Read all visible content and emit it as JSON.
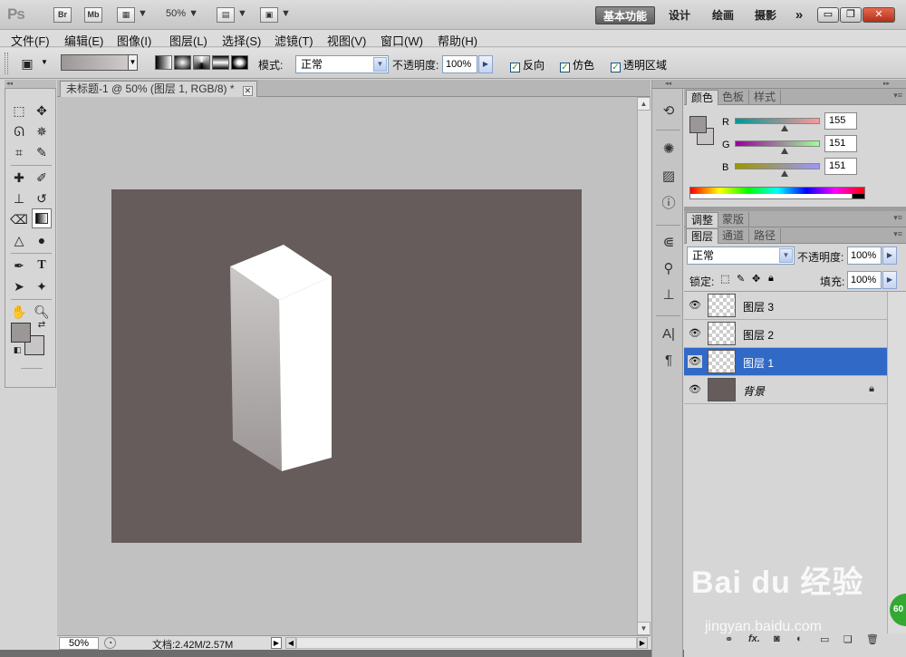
{
  "app": {
    "logo": "Ps",
    "bridge_label": "Br",
    "minibridge_label": "Mb",
    "zoom_display": "50%",
    "workspaces": [
      "基本功能",
      "设计",
      "绘画",
      "摄影"
    ],
    "more_label": "»"
  },
  "menu": [
    "文件(F)",
    "编辑(E)",
    "图像(I)",
    "图层(L)",
    "选择(S)",
    "滤镜(T)",
    "视图(V)",
    "窗口(W)",
    "帮助(H)"
  ],
  "options": {
    "mode_label": "模式:",
    "mode_value": "正常",
    "opacity_label": "不透明度:",
    "opacity_value": "100%",
    "reverse_label": "反向",
    "dither_label": "仿色",
    "transparency_label": "透明区域",
    "gradient_start_color": "#9b9797",
    "gradient_end_color": "#cfcbcb"
  },
  "document": {
    "tab_title": "未标题-1 @ 50% (图层 1, RGB/8) *",
    "canvas_color": "#665c5c",
    "zoom": "50%",
    "doc_info": "文档:2.42M/2.57M"
  },
  "colors": {
    "foreground": "#9b9797",
    "background": "#c7c5c5"
  },
  "color_panel": {
    "tabs": [
      "颜色",
      "色板",
      "样式"
    ],
    "channels": [
      {
        "label": "R",
        "value": "155"
      },
      {
        "label": "G",
        "value": "151"
      },
      {
        "label": "B",
        "value": "151"
      }
    ]
  },
  "adjust_panel": {
    "tabs": [
      "调整",
      "蒙版"
    ]
  },
  "layers_panel": {
    "tabs": [
      "图层",
      "通道",
      "路径"
    ],
    "blend_mode": "正常",
    "opacity_label": "不透明度:",
    "opacity_value": "100%",
    "lock_label": "锁定:",
    "fill_label": "填充:",
    "fill_value": "100%",
    "layers": [
      {
        "name": "图层 3",
        "selected": false
      },
      {
        "name": "图层 2",
        "selected": false
      },
      {
        "name": "图层 1",
        "selected": true
      },
      {
        "name": "背景",
        "selected": false
      }
    ]
  },
  "watermark": {
    "brand": "Bai du 经验",
    "url": "jingyan.baidu.com",
    "badge": "60"
  }
}
